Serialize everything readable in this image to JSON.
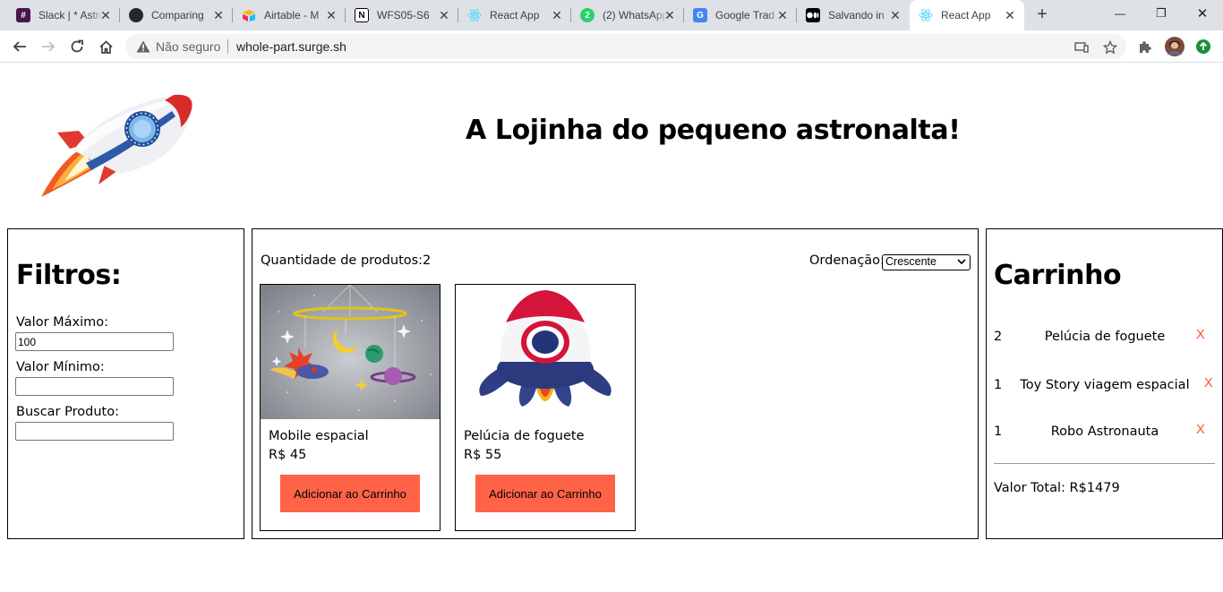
{
  "browser": {
    "tabs": [
      {
        "label": "Slack | * Astro",
        "icon": "slack-icon",
        "color": "#4a154b",
        "glyph": "#"
      },
      {
        "label": "Comparing",
        "icon": "github-icon",
        "color": "#24292e",
        "glyph": "●"
      },
      {
        "label": "Airtable - M",
        "icon": "airtable-icon",
        "color": "#fcb400",
        "glyph": "▲"
      },
      {
        "label": "WFS05-S6",
        "icon": "notion-icon",
        "color": "#000000",
        "glyph": "N"
      },
      {
        "label": "React App",
        "icon": "react-icon",
        "color": "#61dafb",
        "glyph": "⚛"
      },
      {
        "label": "(2) WhatsApp",
        "icon": "whatsapp-icon",
        "color": "#25d366",
        "glyph": "2"
      },
      {
        "label": "Google Trad",
        "icon": "google-translate-icon",
        "color": "#4285f4",
        "glyph": "G"
      },
      {
        "label": "Salvando in",
        "icon": "medium-icon",
        "color": "#000000",
        "glyph": "●●"
      },
      {
        "label": "React App",
        "icon": "react-icon",
        "color": "#61dafb",
        "glyph": "⚛"
      }
    ],
    "close_glyph": "✕",
    "new_tab_glyph": "+",
    "window": {
      "minimize": "—",
      "restore": "❐",
      "close": "✕"
    },
    "security_label": "Não seguro",
    "url": "whole-part.surge.sh"
  },
  "page": {
    "title": "A Lojinha do pequeno astronalta!"
  },
  "filters": {
    "heading": "Filtros:",
    "max_label": "Valor Máximo:",
    "max_value": "100",
    "min_label": "Valor Mínimo:",
    "min_value": "",
    "search_label": "Buscar Produto:",
    "search_value": ""
  },
  "products": {
    "count_label": "Quantidade de produtos:2",
    "sort_label": "Ordenação:",
    "sort_value": "Crescente",
    "items": [
      {
        "name": "Mobile espacial",
        "price": "R$ 45",
        "button": "Adicionar ao Carrinho"
      },
      {
        "name": "Pelúcia de foguete",
        "price": "R$ 55",
        "button": "Adicionar ao Carrinho"
      }
    ]
  },
  "cart": {
    "heading": "Carrinho",
    "items": [
      {
        "qty": "2",
        "name": "Pelúcia de foguete",
        "remove": "X"
      },
      {
        "qty": "1",
        "name": "Toy Story viagem espacial",
        "remove": "X"
      },
      {
        "qty": "1",
        "name": "Robo Astronauta",
        "remove": "X"
      }
    ],
    "total": "Valor Total: R$1479"
  },
  "colors": {
    "button_bg": "#ff6347",
    "remove_x": "#ff4d2e"
  }
}
